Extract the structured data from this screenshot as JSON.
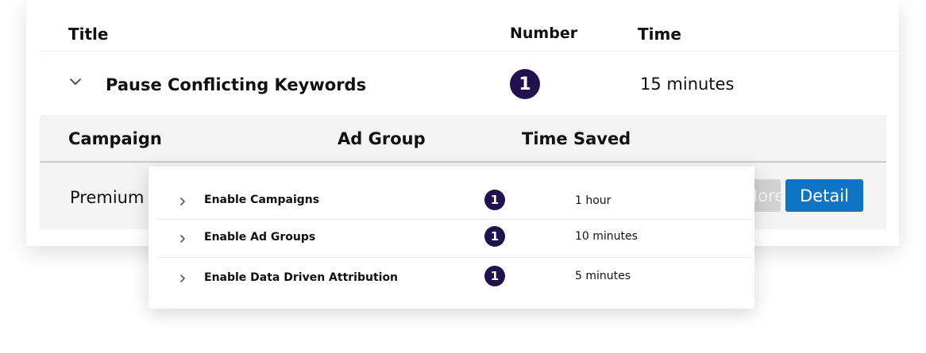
{
  "table": {
    "headers": {
      "title": "Title",
      "number": "Number",
      "time": "Time"
    },
    "row": {
      "title": "Pause Conflicting Keywords",
      "number": "1",
      "time": "15 minutes",
      "expand_icon": "chevron-down-icon"
    }
  },
  "subtable": {
    "headers": {
      "campaign": "Campaign",
      "ad_group": "Ad Group",
      "time_saved": "Time Saved"
    },
    "rows": [
      {
        "campaign": "Premium"
      }
    ],
    "buttons": {
      "more": "More",
      "detail": "Detail"
    }
  },
  "popup": {
    "items": [
      {
        "title": "Enable Campaigns",
        "number": "1",
        "time": "1 hour"
      },
      {
        "title": "Enable Ad Groups",
        "number": "1",
        "time": "10 minutes"
      },
      {
        "title": "Enable Data Driven Attribution",
        "number": "1",
        "time": "5 minutes"
      }
    ]
  },
  "colors": {
    "badge": "#22114f",
    "primary_button": "#0d74c6",
    "disabled_button": "#d1d1d1",
    "subpanel_bg": "#f3f3f3"
  }
}
